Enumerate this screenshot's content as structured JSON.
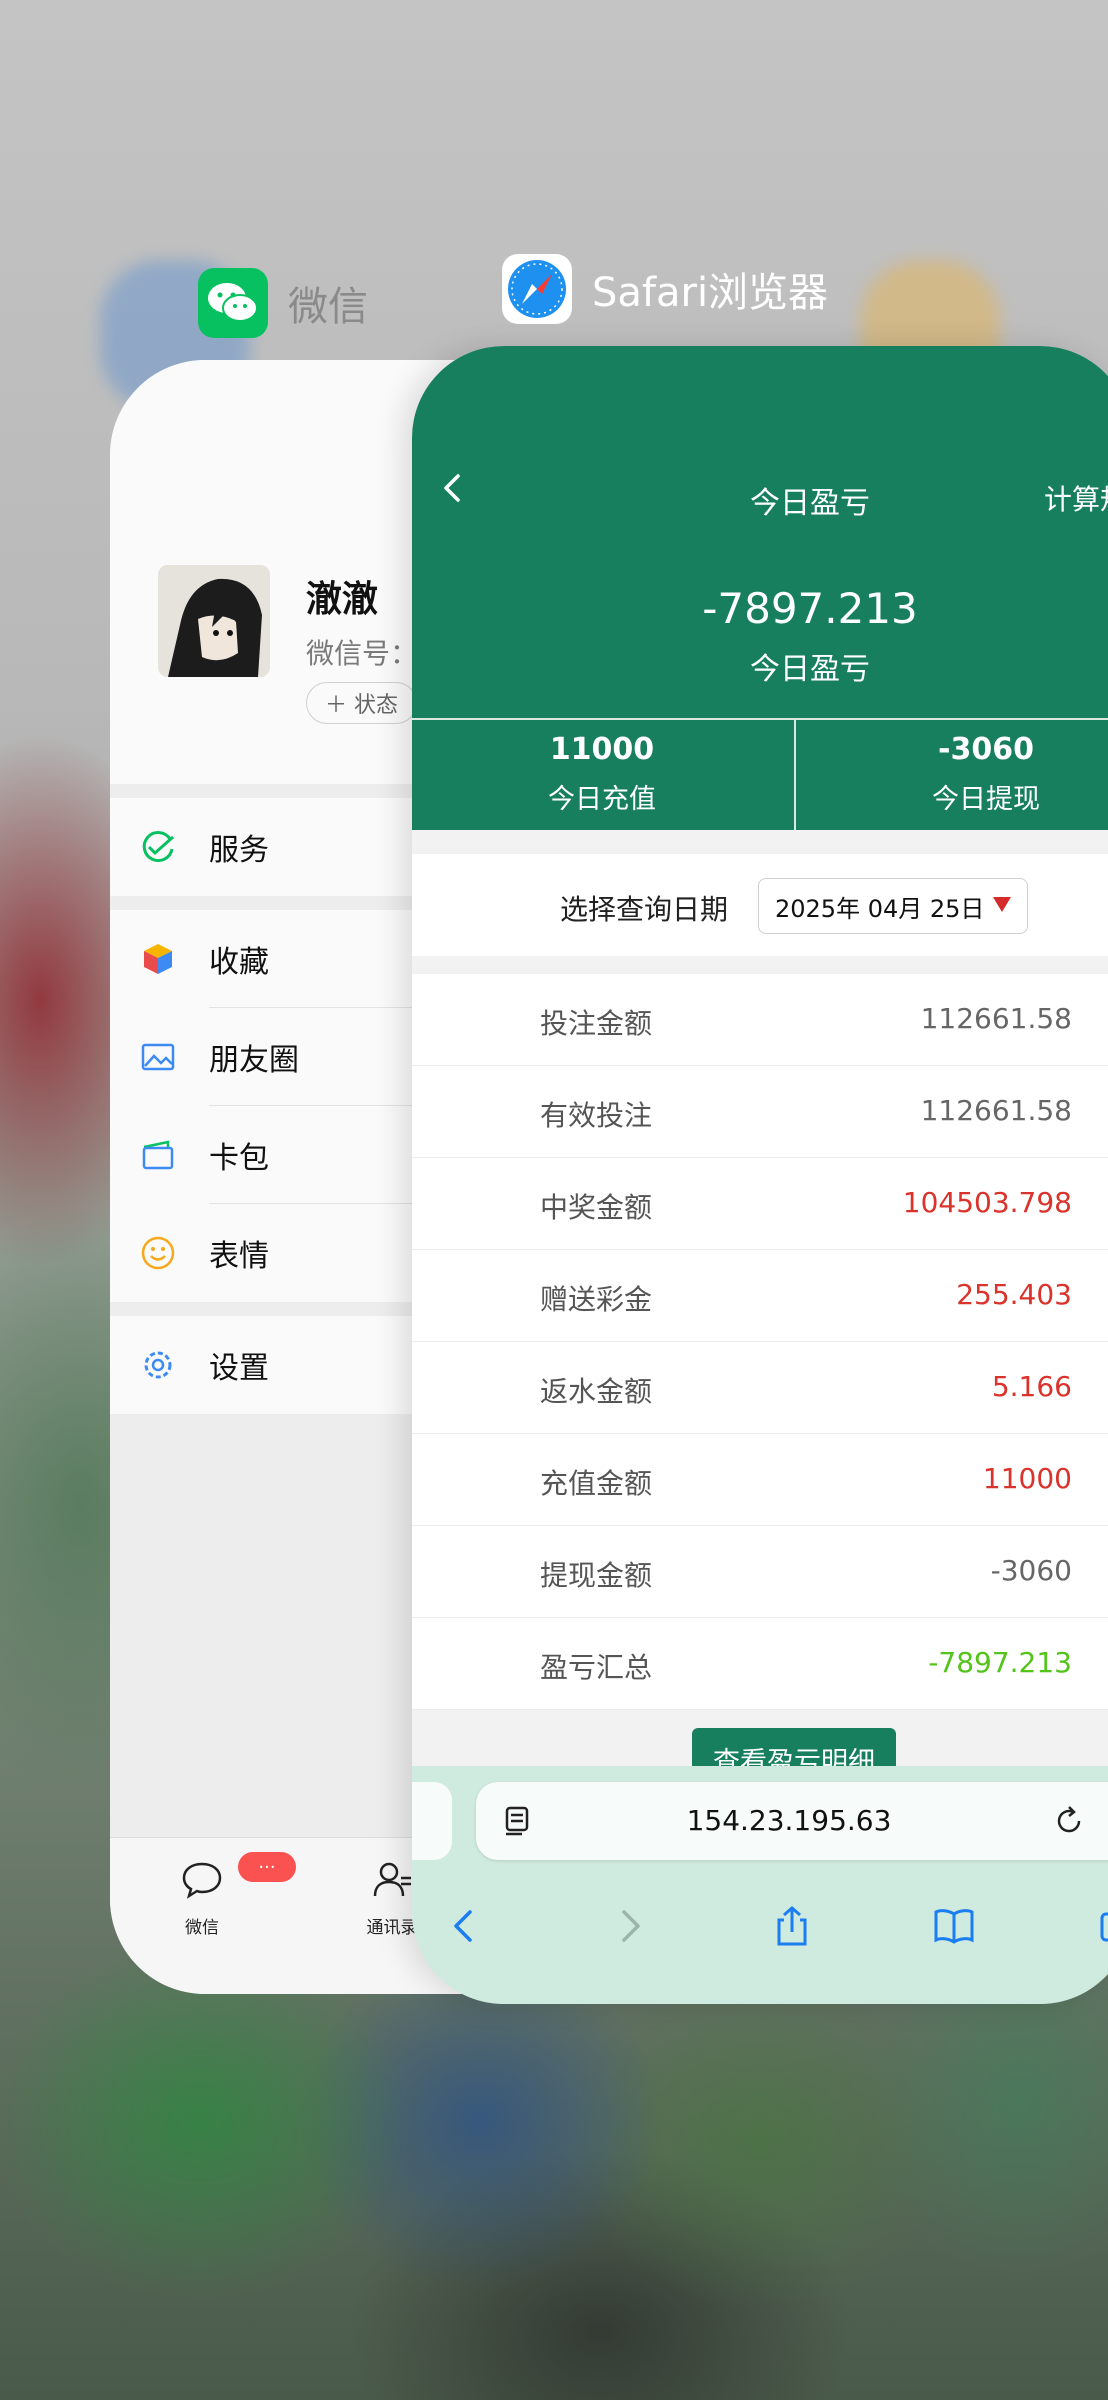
{
  "switcher": {
    "wechat_app_name": "微信",
    "safari_app_name": "Safari浏览器"
  },
  "wechat": {
    "profile": {
      "nickname": "澈澈",
      "wechat_id_label": "微信号：",
      "status_button": "＋ 状态"
    },
    "menu": {
      "services": "服务",
      "favorites": "收藏",
      "moments": "朋友圈",
      "cards": "卡包",
      "stickers": "表情",
      "settings": "设置"
    },
    "tabbar": {
      "chats": "微信",
      "contacts": "通讯录",
      "chats_badge": "···"
    },
    "colors": {
      "accent": "#07c160",
      "badge": "#fa5151"
    }
  },
  "safari": {
    "page": {
      "title": "今日盈亏",
      "right_action": "计算规",
      "profit_value": "-7897.213",
      "profit_label": "今日盈亏",
      "recharge_value": "11000",
      "recharge_label": "今日充值",
      "withdraw_value": "-3060",
      "withdraw_label": "今日提现",
      "date_label": "选择查询日期",
      "date_value": "2025年 04月 25日",
      "rows": [
        {
          "label": "投注金额",
          "value": "112661.58",
          "color": "#666666"
        },
        {
          "label": "有效投注",
          "value": "112661.58",
          "color": "#666666"
        },
        {
          "label": "中奖金额",
          "value": "104503.798",
          "color": "#d9332b"
        },
        {
          "label": "赠送彩金",
          "value": "255.403",
          "color": "#d9332b"
        },
        {
          "label": "返水金额",
          "value": "5.166",
          "color": "#d9332b"
        },
        {
          "label": "充值金额",
          "value": "11000",
          "color": "#d9332b"
        },
        {
          "label": "提现金额",
          "value": "-3060",
          "color": "#666666"
        },
        {
          "label": "盈亏汇总",
          "value": "-7897.213",
          "color": "#52c41a"
        }
      ],
      "detail_button": "查看盈亏明细"
    },
    "url": "154.23.195.63",
    "colors": {
      "header": "#177f5d",
      "toolbar": "#cfeadf",
      "ios_blue": "#1a7ef2"
    }
  }
}
